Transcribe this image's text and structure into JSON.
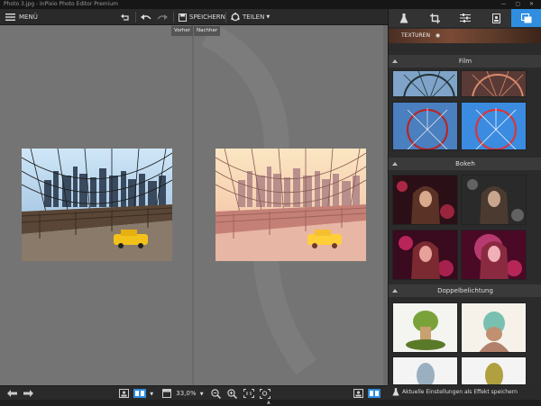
{
  "window": {
    "title": "Photo 3.jpg - InPixio Photo Editor Premium"
  },
  "toolbar": {
    "menu_label": "MENÜ",
    "save_label": "SPEICHERN",
    "share_label": "TEILEN"
  },
  "compare": {
    "before_label": "Vorher",
    "after_label": "Nachher"
  },
  "status": {
    "zoom_value": "33,0%"
  },
  "panel": {
    "texture_label": "TEXTUREN",
    "sections": [
      {
        "title": "Film"
      },
      {
        "title": "Bokeh"
      },
      {
        "title": "Doppelbelichtung"
      }
    ],
    "save_effect_label": "Aktuelle Einstellungen als Effekt speichern"
  },
  "colors": {
    "accent": "#2f8ee0",
    "panel_bg": "#2b2b2b",
    "canvas_bg": "#747474"
  },
  "icons": [
    "hamburger-icon",
    "rotate-icon",
    "undo-icon",
    "redo-icon",
    "save-icon",
    "share-icon",
    "flask-icon",
    "crop-icon",
    "sliders-icon",
    "frame-icon",
    "layers-icon",
    "eye-icon",
    "zoom-in-icon",
    "zoom-out-icon",
    "fit-icon",
    "fullscreen-icon",
    "arrow-left-icon",
    "arrow-right-icon",
    "single-view-icon",
    "split-view-icon",
    "dropdown-arrow-icon"
  ]
}
